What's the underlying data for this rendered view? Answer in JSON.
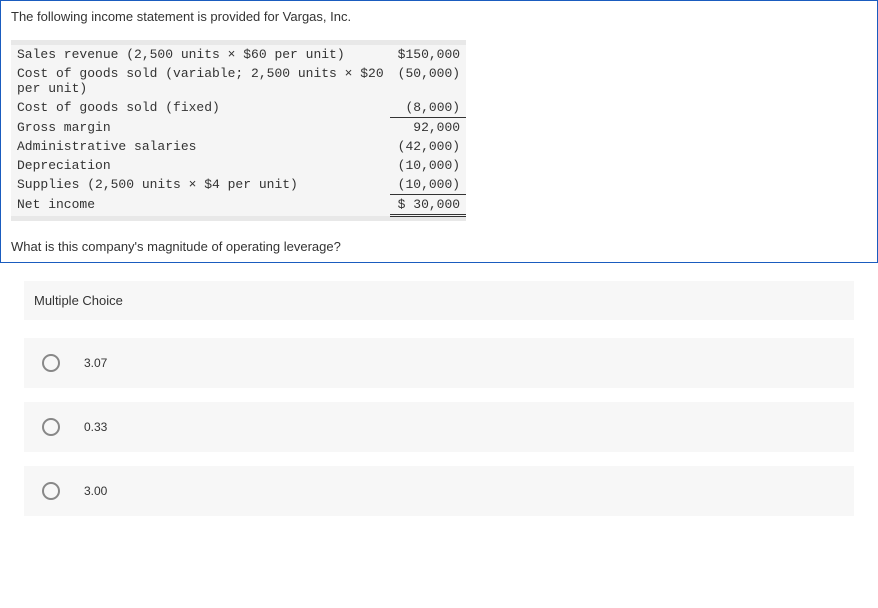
{
  "question": {
    "intro": "The following income statement is provided for Vargas, Inc.",
    "followup": "What is this company's magnitude of operating leverage?"
  },
  "income_statement": {
    "rows": [
      {
        "label": "Sales revenue (2,500 units × $60 per unit)",
        "amount": "$150,000",
        "underline": false
      },
      {
        "label": "Cost of goods sold (variable; 2,500 units × $20 per unit)",
        "amount": "(50,000)",
        "underline": false,
        "wrap": true
      },
      {
        "label": "Cost of goods sold (fixed)",
        "amount": "(8,000)",
        "underline": true
      },
      {
        "label": "Gross margin",
        "amount": "92,000",
        "underline": false
      },
      {
        "label": "Administrative salaries",
        "amount": "(42,000)",
        "underline": false
      },
      {
        "label": "Depreciation",
        "amount": "(10,000)",
        "underline": false
      },
      {
        "label": "Supplies (2,500 units × $4 per unit)",
        "amount": "(10,000)",
        "underline": true
      },
      {
        "label": "Net income",
        "amount": "$ 30,000",
        "underline": false,
        "double": true
      }
    ]
  },
  "multiple_choice": {
    "header": "Multiple Choice",
    "options": [
      {
        "text": "3.07"
      },
      {
        "text": "0.33"
      },
      {
        "text": "3.00"
      }
    ]
  }
}
